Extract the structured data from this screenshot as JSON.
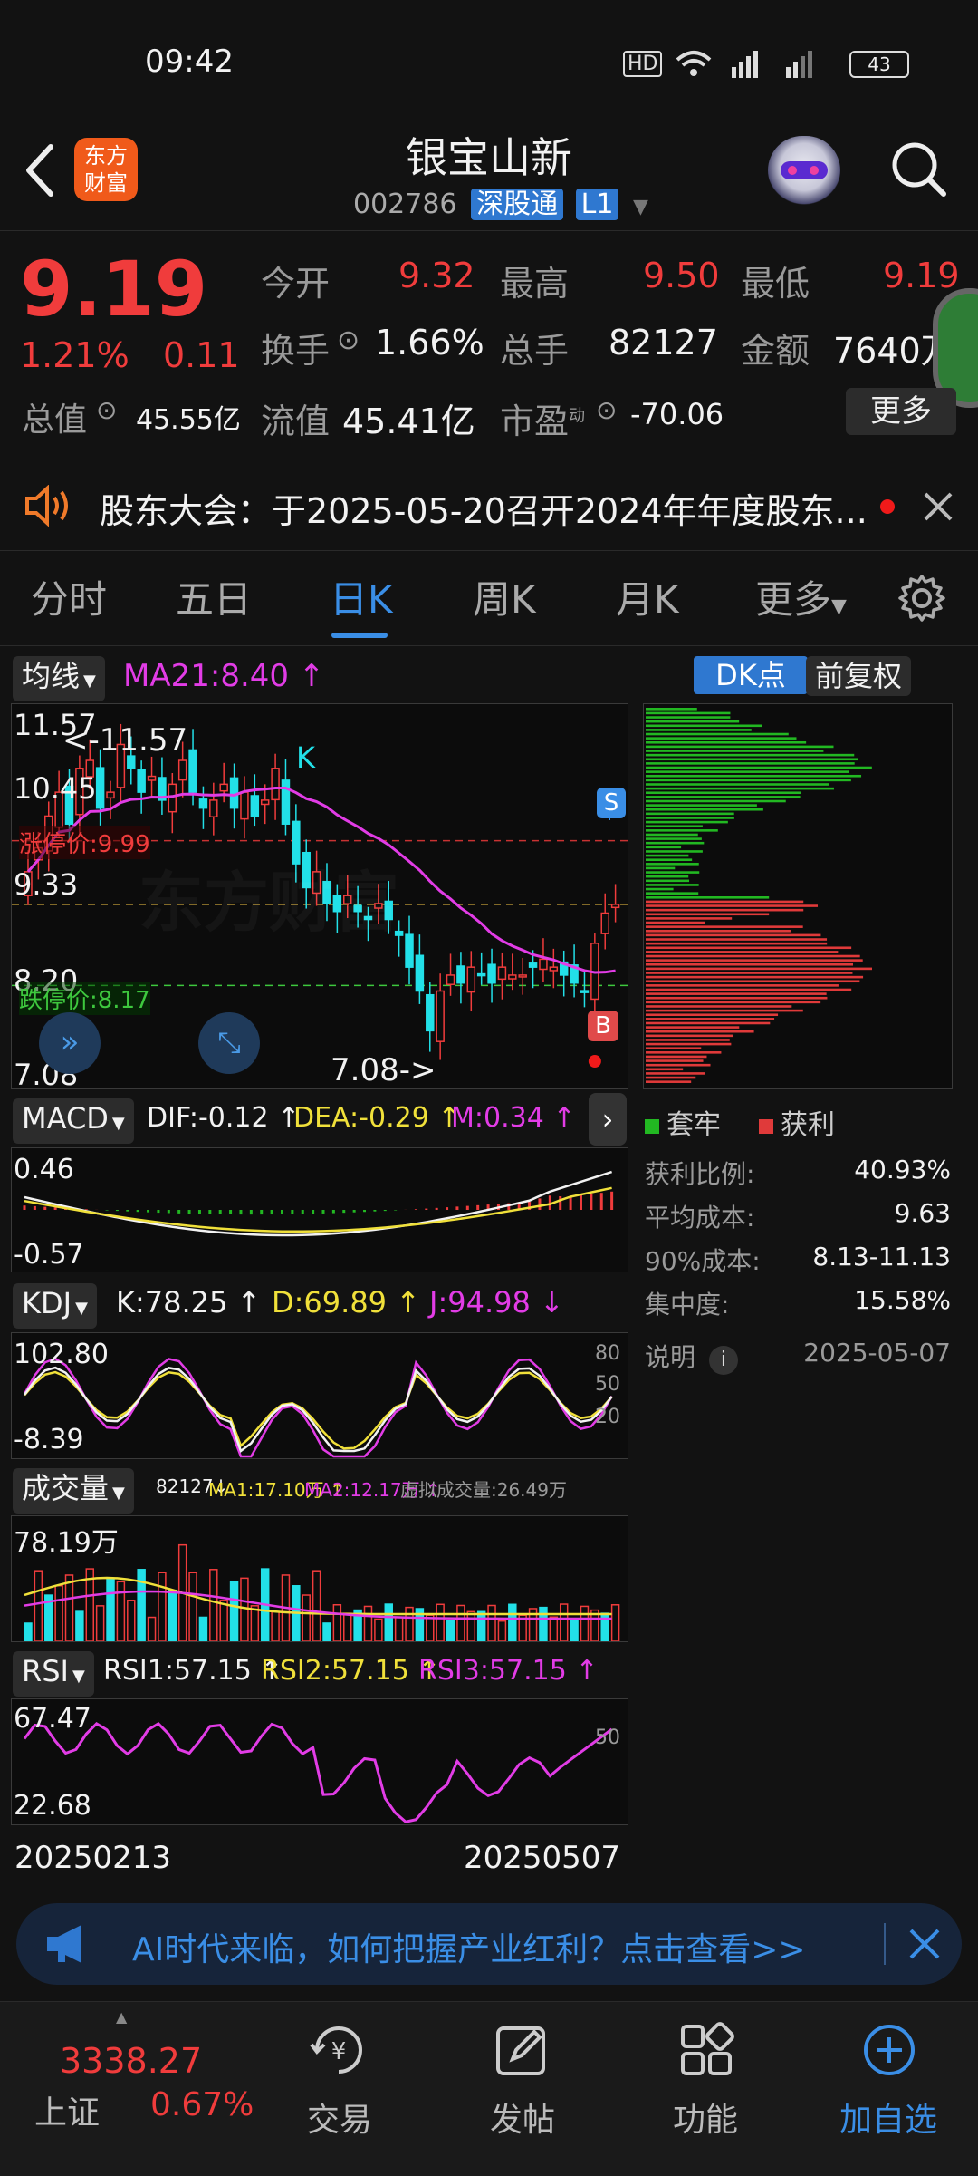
{
  "status_bar": {
    "time": "09:42",
    "battery": "43"
  },
  "header": {
    "logo": "东方财富",
    "title": "银宝山新",
    "code": "002786",
    "badge": "深股通",
    "level": "L1"
  },
  "quote": {
    "price": "9.19",
    "change_pct": "1.21%",
    "change": "0.11",
    "open_label": "今开",
    "open": "9.32",
    "high_label": "最高",
    "high": "9.50",
    "low_label": "最低",
    "low": "9.19",
    "turnover_label": "换手",
    "turnover": "1.66%",
    "volume_label": "总手",
    "volume": "82127",
    "amount_label": "金额",
    "amount": "7640万",
    "mktcap_label": "总值",
    "mktcap": "45.55亿",
    "float_label": "流值",
    "float": "45.41亿",
    "pe_label": "市盈",
    "pe_sup": "动",
    "pe": "-70.06",
    "more_button": "更多"
  },
  "notice": {
    "text": "股东大会：于2025-05-20召开2024年年度股东..."
  },
  "tabs": [
    "分时",
    "五日",
    "日K",
    "周K",
    "月K",
    "更多"
  ],
  "active_tab": "日K",
  "kline": {
    "ma_button": "均线",
    "ma_text": "MA21:8.40 ↑",
    "dk_button": "DK点",
    "adjust_button": "前复权",
    "price_labels": [
      "11.57",
      "10.45",
      "9.33",
      "8.20",
      "7.08"
    ],
    "high_marker": "<-11.57",
    "low_marker": "7.08->",
    "k_marker": "K",
    "limit_up": "涨停价:9.99",
    "limit_down": "跌停价:8.17",
    "sell_marker": "S",
    "buy_marker": "B"
  },
  "chip": {
    "legend_trapped": "套牢",
    "legend_profit": "获利",
    "rows": [
      {
        "label": "获利比例:",
        "value": "40.93%"
      },
      {
        "label": "平均成本:",
        "value": "9.63"
      },
      {
        "label": "90%成本:",
        "value": "8.13-11.13"
      },
      {
        "label": "集中度:",
        "value": "15.58%"
      }
    ],
    "explain": "说明",
    "date": "2025-05-07"
  },
  "macd": {
    "button": "MACD",
    "dif": "DIF:-0.12 ↑",
    "dea": "DEA:-0.29 ↑",
    "m": "M:0.34 ↑",
    "top": "0.46",
    "bottom": "-0.57"
  },
  "kdj": {
    "button": "KDJ",
    "k": "K:78.25 ↑",
    "d": "D:69.89 ↑",
    "j": "J:94.98 ↓",
    "top": "102.80",
    "bottom": "-8.39",
    "levels": [
      "80",
      "50",
      "20"
    ]
  },
  "volume": {
    "button": "成交量",
    "v": "82127↓",
    "ma1": "MA1:17.10万 ↑",
    "ma2": "MA2:12.17万 ↑",
    "virtual": "虚拟成交量:26.49万",
    "top": "78.19万"
  },
  "rsi": {
    "button": "RSI",
    "rsi1": "RSI1:57.15 ↑",
    "rsi2": "RSI2:57.15 ↑",
    "rsi3": "RSI3:57.15 ↑",
    "top": "67.47",
    "bottom": "22.68",
    "level": "50"
  },
  "dates": {
    "start": "20250213",
    "end": "20250507"
  },
  "banner": {
    "text": "AI时代来临，如何把握产业红利？点击查看>>"
  },
  "bottom_nav": {
    "index_value": "3338.27",
    "index_name": "上证",
    "index_change": "0.67%",
    "items": [
      "交易",
      "发帖",
      "功能",
      "加自选"
    ]
  },
  "colors": {
    "up": "#f03c3c",
    "down": "#22e0e8",
    "accent": "#3a8ee6",
    "ma": "#e23ce6",
    "bg": "#121212"
  }
}
